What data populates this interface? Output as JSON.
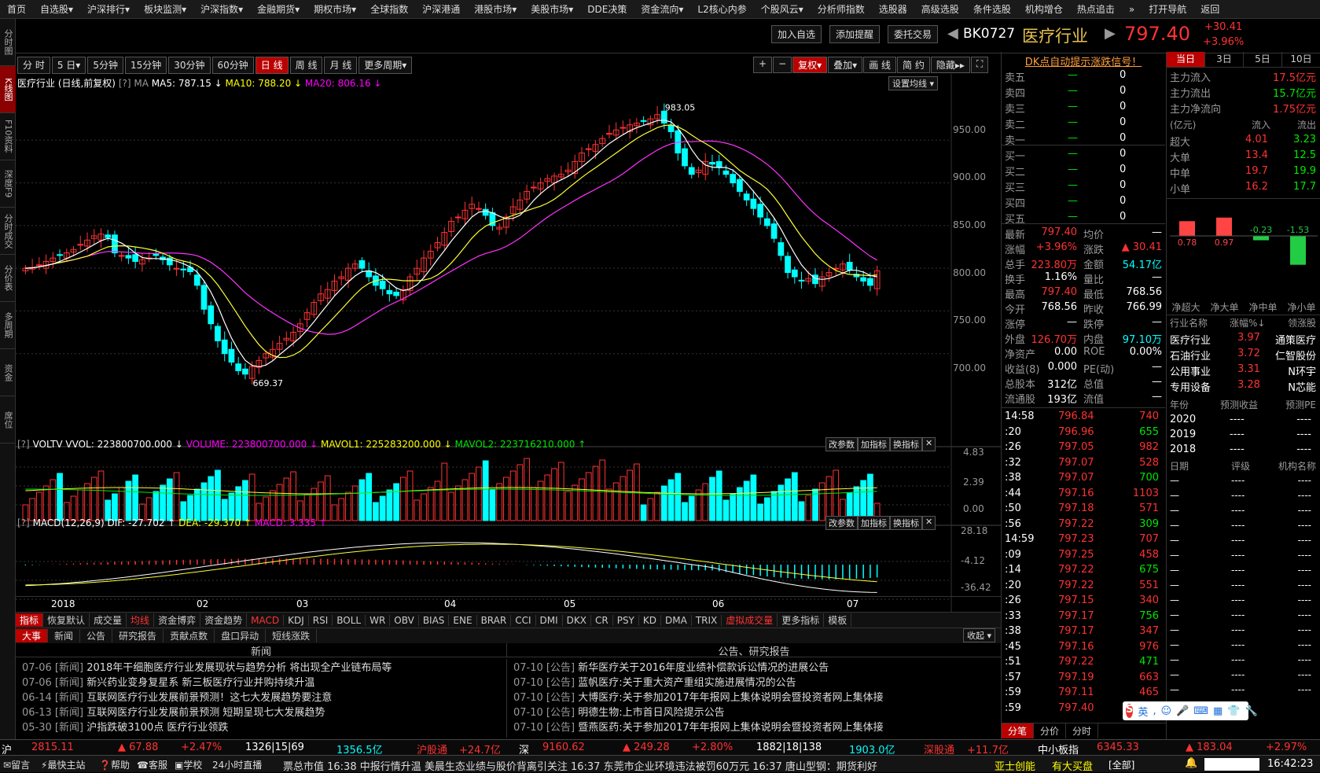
{
  "menu": [
    "首页",
    "自选股▾",
    "沪深排行▾",
    "板块监测▾",
    "沪深指数▾",
    "金融期货▾",
    "期权市场▾",
    "全球指数",
    "沪深港通",
    "港股市场▾",
    "美股市场▾",
    "DDE决策",
    "资金流向▾",
    "L2核心内参",
    "个股风云▾",
    "分析师指数",
    "选股器",
    "高级选股",
    "条件选股",
    "机构增仓",
    "热点追击",
    "»",
    "打开导航",
    "返回"
  ],
  "left_tabs": [
    "分时图",
    "K线图",
    "F10资料",
    "深度F9",
    "分时成交",
    "分价表",
    "多周期",
    "资金",
    "席位"
  ],
  "header": {
    "add_watch": "加入自选",
    "add_alert": "添加提醒",
    "trade": "委托交易",
    "code": "BK0727",
    "name": "医疗行业",
    "price": "797.40",
    "change": "+30.41",
    "pct": "+3.96%"
  },
  "periods": [
    "分 时",
    "5 日▾",
    "5分钟",
    "15分钟",
    "30分钟",
    "60分钟",
    "日 线",
    "周 线",
    "月 线",
    "更多周期▾"
  ],
  "tools": [
    "+",
    "−",
    "复权▾",
    "叠加▾",
    "画 线",
    "简 约",
    "隐藏▸▸",
    "⛶"
  ],
  "ma_line": {
    "title": "医疗行业 (日线,前复权)",
    "ma5": "MA5: 787.15 ↓",
    "ma10": "MA10: 788.20 ↓",
    "ma20": "MA20: 806.16 ↓",
    "set": "设置均线 ▾"
  },
  "price_axis": [
    "950.00",
    "900.00",
    "850.00",
    "800.00",
    "750.00",
    "700.00"
  ],
  "hi_label": "983.05",
  "lo_label": "669.37",
  "vol_line": {
    "name": "VOLTV",
    "vvol": "VVOL: 223800700.000 ↓",
    "volume": "VOLUME: 223800700.000 ↓",
    "mavol1": "MAVOL1: 225283200.000 ↓",
    "mavol2": "MAVOL2: 223716210.000 ↑"
  },
  "vol_axis": [
    "4.83",
    "2.39",
    "0.00"
  ],
  "macd_line": {
    "name": "MACD(12,26,9)",
    "dif": "DIF: -27.702 ↑",
    "dea": "DEA: -29.370 ↑",
    "macd": "MACD: 3.335 ↑"
  },
  "macd_axis": [
    "28.18",
    "-4.12",
    "-36.42"
  ],
  "sub_btns": [
    "改参数",
    "加指标",
    "换指标"
  ],
  "date_axis": [
    "2018",
    "02",
    "03",
    "04",
    "05",
    "06",
    "07"
  ],
  "indicators": [
    "指标",
    "恢复默认",
    "成交量",
    "均线",
    "资金博弈",
    "资金趋势",
    "MACD",
    "KDJ",
    "RSI",
    "BOLL",
    "WR",
    "OBV",
    "BIAS",
    "ENE",
    "BRAR",
    "CCI",
    "DMI",
    "DKX",
    "CR",
    "PSY",
    "KD",
    "DMA",
    "TRIX",
    "虚拟成交量",
    "更多指标",
    "模板"
  ],
  "news_tabs": [
    "大事",
    "新闻",
    "公告",
    "研究报告",
    "贡献点数",
    "盘口异动",
    "短线涨跌"
  ],
  "news_collapse": "收起 ▾",
  "news_head": "新闻",
  "ann_head": "公告、研究报告",
  "news": [
    [
      "07-06",
      "[新闻]",
      "2018年干细胞医疗行业发展现状与趋势分析 将出现全产业链布局等"
    ],
    [
      "07-06",
      "[新闻]",
      "新兴药业变身复星系 新三板医疗行业并购持续升温"
    ],
    [
      "06-14",
      "[新闻]",
      "互联网医疗行业发展前景预测！这七大发展趋势要注意"
    ],
    [
      "06-13",
      "[新闻]",
      "互联网医疗行业发展前景预测 短期呈现七大发展趋势"
    ],
    [
      "05-30",
      "[新闻]",
      "沪指跌破3100点 医疗行业领跌"
    ]
  ],
  "anns": [
    [
      "07-10",
      "[公告]",
      "新华医疗关于2016年度业绩补偿款诉讼情况的进展公告"
    ],
    [
      "07-10",
      "[公告]",
      "蓝帆医疗:关于重大资产重组实施进展情况的公告"
    ],
    [
      "07-10",
      "[公告]",
      "大博医疗:关于参加2017年年报网上集体说明会暨投资者网上集体接"
    ],
    [
      "07-10",
      "[公告]",
      "明德生物:上市首日风险提示公告"
    ],
    [
      "07-10",
      "[公告]",
      "暨燕医药:关于参加2017年年报网上集体说明会暨投资者网上集体接"
    ]
  ],
  "dk": "DK点自动提示涨跌信号！",
  "sell": [
    "卖五",
    "卖四",
    "卖三",
    "卖二",
    "卖一"
  ],
  "buy": [
    "买一",
    "买二",
    "买三",
    "买四",
    "买五"
  ],
  "quote": [
    [
      "最新",
      "797.40",
      "均价",
      "—"
    ],
    [
      "涨幅",
      "+3.96%",
      "涨跌",
      "▲ 30.41"
    ],
    [
      "总手",
      "223.80万",
      "金额",
      "54.17亿"
    ],
    [
      "换手",
      "1.16%",
      "量比",
      "—"
    ],
    [
      "最高",
      "797.40",
      "最低",
      "768.56"
    ],
    [
      "今开",
      "768.56",
      "昨收",
      "766.99"
    ],
    [
      "涨停",
      "—",
      "跌停",
      "—"
    ],
    [
      "外盘",
      "126.70万",
      "内盘",
      "97.10万"
    ],
    [
      "净资产",
      "0.00",
      "ROE",
      "0.00%"
    ],
    [
      "收益(8)",
      "0.000",
      "PE(动)",
      "—"
    ],
    [
      "总股本",
      "312亿",
      "总值",
      "—"
    ],
    [
      "流通股",
      "193亿",
      "流值",
      "—"
    ]
  ],
  "ticks": [
    [
      "14:58",
      "796.84",
      "740"
    ],
    [
      ":20",
      "796.96",
      "655"
    ],
    [
      ":26",
      "797.05",
      "982"
    ],
    [
      ":32",
      "797.07",
      "528"
    ],
    [
      ":38",
      "797.07",
      "700"
    ],
    [
      ":44",
      "797.16",
      "1103"
    ],
    [
      ":50",
      "797.18",
      "571"
    ],
    [
      ":56",
      "797.22",
      "309"
    ],
    [
      "14:59",
      "797.23",
      "707"
    ],
    [
      ":09",
      "797.25",
      "458"
    ],
    [
      ":14",
      "797.22",
      "675"
    ],
    [
      ":20",
      "797.22",
      "551"
    ],
    [
      ":26",
      "797.15",
      "340"
    ],
    [
      ":33",
      "797.17",
      "756"
    ],
    [
      ":38",
      "797.17",
      "347"
    ],
    [
      ":45",
      "797.16",
      "976"
    ],
    [
      ":51",
      "797.22",
      "471"
    ],
    [
      ":57",
      "797.19",
      "663"
    ],
    [
      ":59",
      "797.11",
      "465"
    ],
    [
      ":59",
      "797.40",
      "2"
    ]
  ],
  "tick_tabs": [
    "分笔",
    "分价",
    "分时"
  ],
  "flow_tabs": [
    "当日",
    "3日",
    "5日",
    "10日"
  ],
  "flow": [
    [
      "主力流入",
      "17.5亿元"
    ],
    [
      "主力流出",
      "15.7亿元"
    ],
    [
      "主力净流向",
      "1.75亿元"
    ]
  ],
  "flow_head": [
    "(亿元)",
    "流入",
    "流出"
  ],
  "flow_rows": [
    [
      "超大",
      "4.01",
      "3.23"
    ],
    [
      "大单",
      "13.4",
      "12.5"
    ],
    [
      "中单",
      "19.7",
      "19.9"
    ],
    [
      "小单",
      "16.2",
      "17.7"
    ]
  ],
  "flow_bars": [
    [
      "0.78",
      0.78
    ],
    [
      "0.97",
      0.97
    ],
    [
      "-0.23",
      -0.23
    ],
    [
      "-1.53",
      -1.53
    ]
  ],
  "flow_bar_labels": [
    "净超大",
    "净大单",
    "净中单",
    "净小单"
  ],
  "sector_head": [
    "行业名称",
    "涨幅%↓",
    "领涨股"
  ],
  "sectors": [
    [
      "医疗行业",
      "3.97",
      "通策医疗"
    ],
    [
      "石油行业",
      "3.72",
      "仁智股份"
    ],
    [
      "公用事业",
      "3.31",
      "N环宇"
    ],
    [
      "专用设备",
      "3.28",
      "N芯能"
    ]
  ],
  "forecast_head": [
    "年份",
    "预测收益",
    "预测PE"
  ],
  "forecast": [
    [
      "2020",
      "----",
      "----"
    ],
    [
      "2019",
      "----",
      "----"
    ],
    [
      "2018",
      "----",
      "----"
    ]
  ],
  "rating_head": [
    "日期",
    "评级",
    "机构名称"
  ],
  "status1": {
    "sh": "沪",
    "sh_v": "2815.11",
    "sh_c": "▲ 67.88",
    "sh_p": "+2.47%",
    "sh_n": "1326|15|69",
    "sh_a": "1356.5亿",
    "hgt": "沪股通",
    "hgt_v": "+24.7亿",
    "sz": "深",
    "sz_v": "9160.62",
    "sz_c": "▲ 249.28",
    "sz_p": "+2.80%",
    "sz_n": "1882|18|138",
    "sz_a": "1903.0亿",
    "sgt": "深股通",
    "sgt_v": "+11.7亿",
    "zxb": "中小板指",
    "zxb_v": "6345.33",
    "zxb_c": "▲ 183.04",
    "zxb_p": "+2.97%"
  },
  "status2": {
    "items": [
      "留言",
      "最快主站",
      "帮助",
      "客服",
      "学校",
      "24小时直播"
    ],
    "ticker": "票总市值 16:38 中报行情升温 美晨生态业绩与股价背离引关注 16:37 东莞市企业环境违法被罚60万元 16:37 唐山型钢：期货利好",
    "stock": "亚士创能",
    "hot": "有大买盘",
    "all": "[全部]",
    "time": "16:42:23"
  },
  "ime": "英"
}
